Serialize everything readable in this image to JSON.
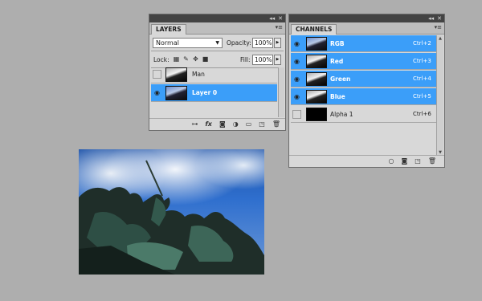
{
  "layers_panel": {
    "strip_glyphs": [
      "◂◂",
      "✕"
    ],
    "tab_label": "LAYERS",
    "menu_icon": "panel-menu-icon",
    "blend_mode": "Normal",
    "opacity_label": "Opacity:",
    "opacity_value": "100%",
    "lock_label": "Lock:",
    "fill_label": "Fill:",
    "fill_value": "100%",
    "layers": [
      {
        "name": "Man",
        "visible": false,
        "selected": false
      },
      {
        "name": "Layer 0",
        "visible": true,
        "selected": true
      }
    ],
    "bottom_icons": [
      "link-layers-icon",
      "fx-icon",
      "layer-mask-icon",
      "adjustment-layer-icon",
      "new-group-icon",
      "new-layer-icon",
      "trash-icon"
    ]
  },
  "channels_panel": {
    "strip_glyphs": [
      "◂◂",
      "✕"
    ],
    "tab_label": "CHANNELS",
    "channels": [
      {
        "name": "RGB",
        "shortcut": "Ctrl+2",
        "selected": true
      },
      {
        "name": "Red",
        "shortcut": "Ctrl+3",
        "selected": true
      },
      {
        "name": "Green",
        "shortcut": "Ctrl+4",
        "selected": true
      },
      {
        "name": "Blue",
        "shortcut": "Ctrl+5",
        "selected": true
      },
      {
        "name": "Alpha 1",
        "shortcut": "Ctrl+6",
        "selected": false
      }
    ],
    "bottom_icons": [
      "load-selection-icon",
      "save-selection-icon",
      "new-channel-icon",
      "trash-icon"
    ]
  },
  "colors": {
    "selection": "#3b9ef9",
    "panel_bg": "#d8d8d8",
    "workspace_bg": "#aeaeae"
  }
}
